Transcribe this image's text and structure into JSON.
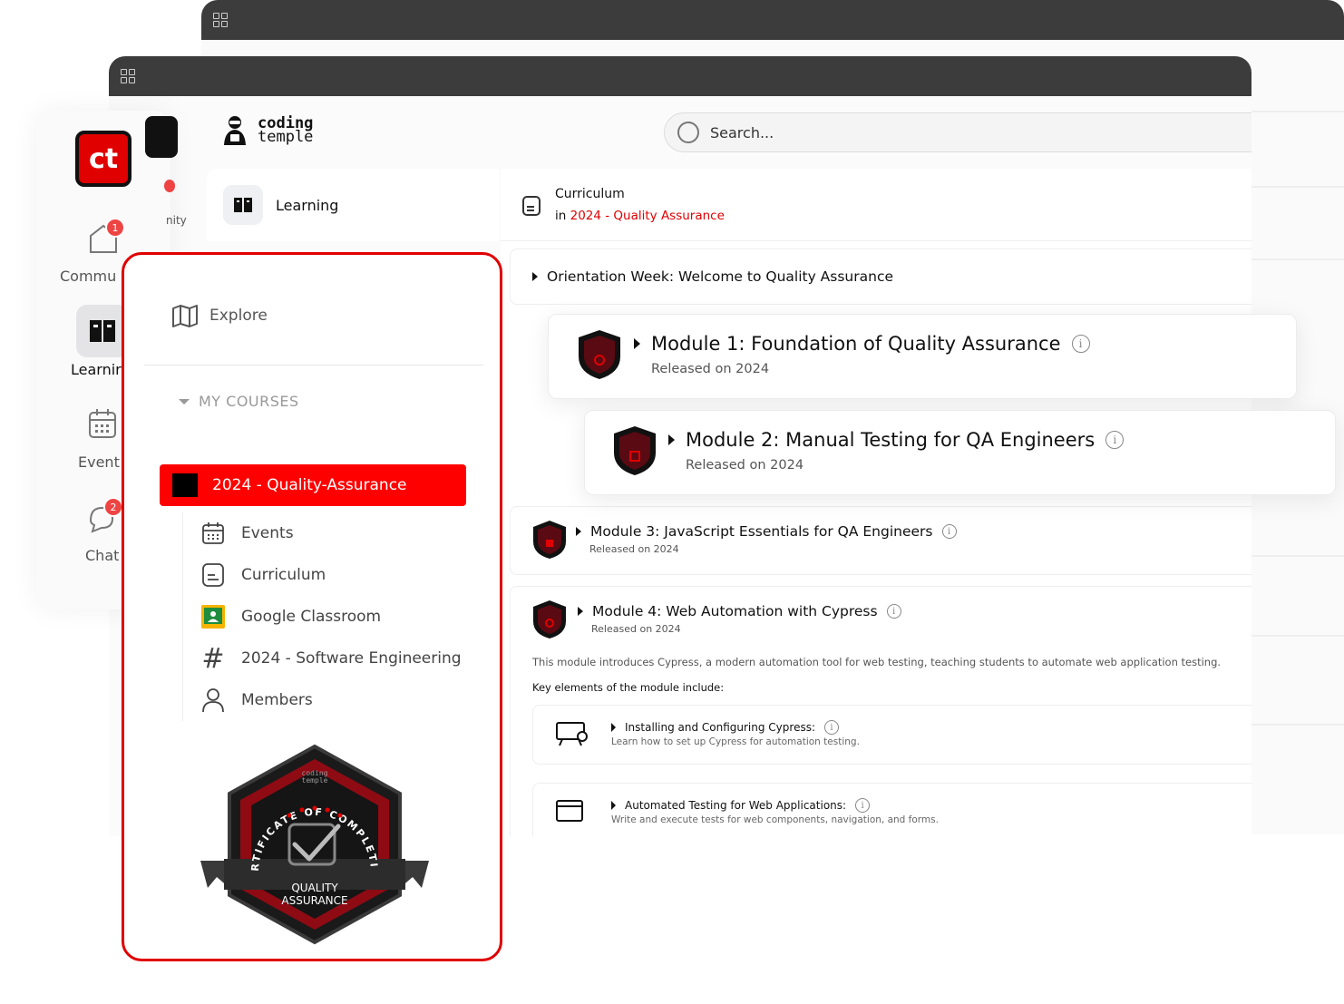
{
  "header": {
    "logo_line1": "coding",
    "logo_line2": "temple",
    "search_placeholder": "Search..."
  },
  "rail": {
    "logo": "ct",
    "items": [
      {
        "label": "Commu",
        "badge": "1"
      },
      {
        "label": "Learnir",
        "badge": ""
      },
      {
        "label": "Event",
        "badge": ""
      },
      {
        "label": "Chat",
        "badge": "2"
      }
    ],
    "partial_label": "nity"
  },
  "learning_tab": {
    "label": "Learning"
  },
  "curriculum": {
    "title": "Curriculum",
    "in": "in",
    "course": "2024 - Quality Assurance"
  },
  "orientation": {
    "title": "Orientation Week: Welcome to Quality Assurance"
  },
  "modules": [
    {
      "title": "Module 1: Foundation of Quality Assurance",
      "released": "Released on 2024"
    },
    {
      "title": "Module 2: Manual Testing for QA Engineers",
      "released": "Released on 2024"
    },
    {
      "title": "Module 3: JavaScript Essentials for QA Engineers",
      "released": "Released on 2024"
    },
    {
      "title": "Module 4: Web Automation with Cypress",
      "released": "Released on 2024",
      "description": "This module introduces Cypress, a modern automation tool for web testing, teaching students to automate web application testing.",
      "key_label": "Key elements of the module include:",
      "elements": [
        {
          "title": "Installing and Configuring Cypress:",
          "desc": "Learn how to set up Cypress for automation testing."
        },
        {
          "title": "Automated Testing for Web Applications:",
          "desc": "Write and execute tests for web components, navigation, and forms."
        }
      ]
    }
  ],
  "panel": {
    "explore": "Explore",
    "my_courses": "MY COURSES",
    "active_course": "2024 - Quality-Assurance",
    "nav": [
      "Events",
      "Curriculum",
      "Google Classroom",
      "2024 - Software Engineering",
      "Members"
    ]
  },
  "badge": {
    "arc_text": "CERTIFICATE OF COMPLETION",
    "line1": "QUALITY",
    "line2": "ASSURANCE",
    "brand1": "coding",
    "brand2": "temple"
  },
  "colors": {
    "accent": "#e00000",
    "titlebar": "#3c3c3c"
  }
}
